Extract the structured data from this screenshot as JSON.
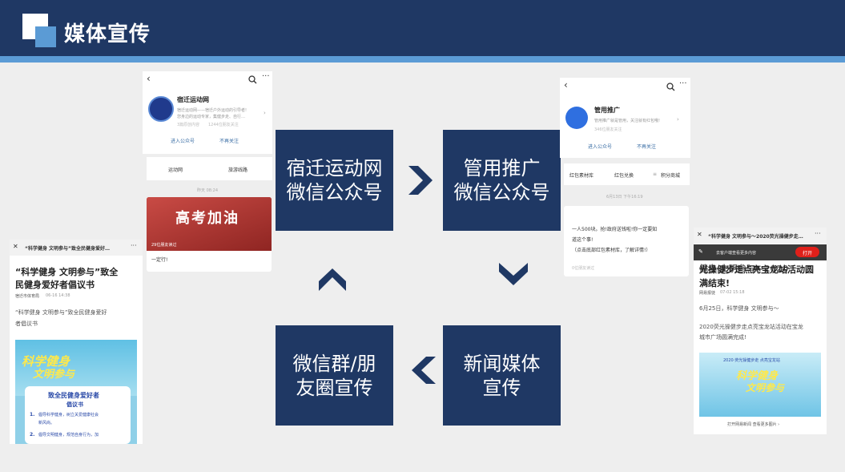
{
  "header": {
    "title": "媒体宣传"
  },
  "boxes": {
    "b1": {
      "line1": "宿迁运动网",
      "line2": "微信公众号"
    },
    "b2": {
      "line1": "管用推广",
      "line2": "微信公众号"
    },
    "b3": {
      "line1": "新闻媒体",
      "line2": "宣传"
    },
    "b4": {
      "line1": "微信群/朋",
      "line2": "友圈宣传"
    }
  },
  "card1": {
    "name": "宿迁运动网",
    "desc1": "宿迁运动网——宿迁户外运动的引导者!",
    "desc2": "您身边的运动专家，集健步走、自行…",
    "stats": "3篇原创内容",
    "friends": "1244位朋友关注",
    "enter": "进入公众号",
    "unfollow": "不再关注",
    "tab1": "运动网",
    "tab2": "旅游线路",
    "time": "昨天 08:24",
    "banner": "高考加油",
    "banner_sub": "29位朋友读过",
    "caption": "一定行!"
  },
  "card2": {
    "name": "管用推广",
    "desc": "管用推广就是管用，关注就有红包哦!",
    "friends": "346位朋友关注",
    "enter": "进入公众号",
    "unfollow": "不再关注",
    "tab1": "红包素材库",
    "tab2": "红包兑换",
    "tab3": "积分商城",
    "time": "6月13日 下午16:19",
    "msg1": "一人500块。抢!政府送钱啦!你一定要知",
    "msg2": "道这个事!",
    "msg3": "（点击底部红包素材库，了解详情!）",
    "read": "0位朋友读过"
  },
  "card3": {
    "topbar": "“科学健身 文明参与”致全民健身爱好…",
    "title1": "“科学健身 文明参与”致全",
    "title2": "民健身爱好者倡议书",
    "source": "宿迁市体育局",
    "date": "06-16 14:38",
    "body1": "“科学健身 文明参与”致全民健身爱好",
    "body2": "者倡议书",
    "poster_big": "科学健身",
    "poster_big2": "文明参与",
    "poster_title": "致全民健身爱好者",
    "poster_sub": "倡议书",
    "item1a": "倡导科学健身，树立关爱健康社会",
    "item1b": "新风尚。",
    "item2a": "倡导文明健身，规范自身行为，加"
  },
  "card4": {
    "topbar": "“科学健身 文明参与～2020荧光操健步走…",
    "banner_hint": "去客户端查看更多内容",
    "open": "打开",
    "title1": "健身 文明参与～2020",
    "title2": "光操健步走点亮宝龙站活动圆",
    "title3": "满结束!",
    "source": "网易报徒",
    "date": "07-02 15:18",
    "body1": "6月25日，科学健身 文明参与～",
    "body2": "2020荧光操健步走点亮宝龙站活动在宝龙",
    "body3": "城市广场圆满完成!",
    "poster_top": "2020·荧光操健步走 点亮宝龙站",
    "poster_big": "科学健身",
    "poster_big2": "文明参与",
    "footer": "打开网易新闻 查看更多图片 ›"
  }
}
